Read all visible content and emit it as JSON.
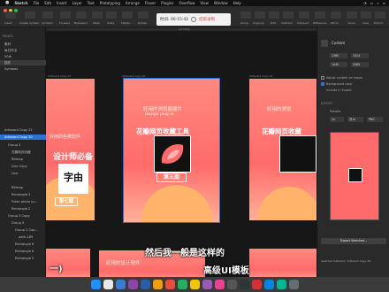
{
  "menubar": {
    "app": "Sketch",
    "items": [
      "File",
      "Edit",
      "Insert",
      "Layer",
      "Text",
      "Prototyping",
      "Arrange",
      "Flaver",
      "Plugins",
      "Overflow",
      "View",
      "Window",
      "Help"
    ]
  },
  "recorder": {
    "time": "时间: 00:15:42",
    "end_label": "结束录制"
  },
  "toolbar_labels": [
    "Insert",
    "Create Symbol",
    "Symbols",
    "Forward",
    "Backward",
    "Mask",
    "Scale",
    "Flatten",
    "Rotate",
    "Group",
    "Ungroup",
    "Edit",
    "Subtract",
    "Intersect",
    "Difference",
    "Mirror",
    "Cloud",
    "View",
    "Export"
  ],
  "left_panel": {
    "pages_header": "PAGES",
    "pages": [
      "素材",
      "每日作业",
      "00水",
      "插件",
      "Symbols"
    ],
    "layers": [
      "Artboard Copy 22",
      "Artboard Copy 20",
      "Group 3",
      "花瓣网页收藏",
      "Bitmap",
      "Line Copy",
      "Line",
      "Bitmap",
      "Rectangle 3",
      "Fresh photo pr...",
      "Rectangle 2",
      "Group 3 Copy",
      "Group 5",
      "Group 2 Cop...",
      "path-189",
      "Rectangle 6",
      "Rectangle 6",
      "Rectangle 5"
    ]
  },
  "canvas": {
    "ruler_label": "a/1700px",
    "artboards": [
      {
        "label": "Artboard Copy 21",
        "title": "设计师必备",
        "sub": "好用的各类软件",
        "btn": "第七期",
        "glyph": "字由"
      },
      {
        "label": "Artboard Copy 20",
        "title": "花瓣网页收藏工具",
        "sub": "好用的浏览器插件",
        "sub2": "Design plug-in",
        "btn": "第五期"
      },
      {
        "label": "Artboard Copy 19",
        "title": "花瓣网页收藏",
        "sub": "好用的浏览"
      }
    ],
    "bottom_title": "好用的设计软件",
    "caption_line1": "然后我一般是这样的",
    "caption_line2": "高级UI模板",
    "left_dash": "一)"
  },
  "right_panel": {
    "custom_label": "Custom",
    "w": "1380",
    "h": "1024",
    "x": "1440",
    "y": "2085",
    "adjust_label": "Adjust content on resize",
    "bg_label": "Background color",
    "include_label": "Include in Export",
    "export_header": "EXPORT",
    "presets": "Presets",
    "size": "1x",
    "prefix": "@1x",
    "format": "PNG",
    "export_button": "Export Selected...",
    "selected_text": "Selected artboard: 'Artboard Copy 20'"
  },
  "colors": {
    "accent": "#2f6fd8",
    "artboard": "#ff6b6b",
    "rec_end": "#e04b4b"
  }
}
